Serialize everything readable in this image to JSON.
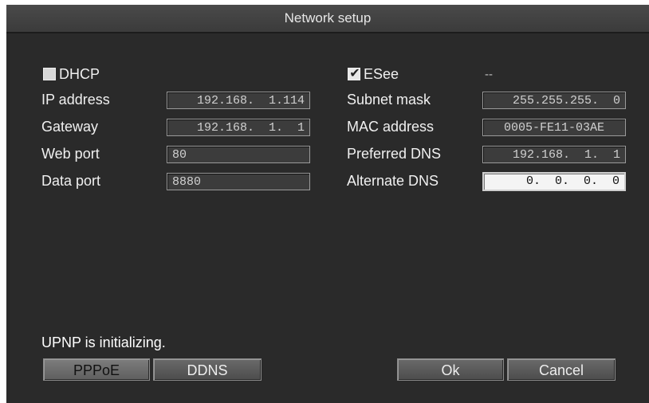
{
  "dialog": {
    "title": "Network setup"
  },
  "left": {
    "dhcp": {
      "label": "DHCP",
      "checked": false
    },
    "ip_address": {
      "label": "IP address",
      "value": "192.168.  1.114"
    },
    "gateway": {
      "label": "Gateway",
      "value": "192.168.  1.  1"
    },
    "web_port": {
      "label": "Web port",
      "value": "80"
    },
    "data_port": {
      "label": "Data port",
      "value": "8880"
    }
  },
  "right": {
    "esee": {
      "label": "ESee",
      "checked": true,
      "status": "--"
    },
    "subnet_mask": {
      "label": "Subnet mask",
      "value": "255.255.255.  0"
    },
    "mac_address": {
      "label": "MAC address",
      "value": "0005-FE11-03AE"
    },
    "preferred_dns": {
      "label": "Preferred DNS",
      "value": "192.168.  1.  1"
    },
    "alternate_dns": {
      "label": "Alternate DNS",
      "value": "  0.  0.  0.  0"
    }
  },
  "status_message": "UPNP is initializing.",
  "buttons": {
    "pppoe": "PPPoE",
    "ddns": "DDNS",
    "ok": "Ok",
    "cancel": "Cancel"
  }
}
